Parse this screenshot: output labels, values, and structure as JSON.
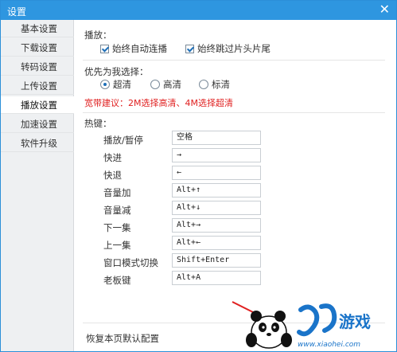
{
  "window": {
    "title": "设置",
    "close_glyph": "✕"
  },
  "sidebar": {
    "items": [
      {
        "label": "基本设置"
      },
      {
        "label": "下载设置"
      },
      {
        "label": "转码设置"
      },
      {
        "label": "上传设置"
      },
      {
        "label": "播放设置"
      },
      {
        "label": "加速设置"
      },
      {
        "label": "软件升级"
      }
    ],
    "active_index": 4
  },
  "playback": {
    "label": "播放：",
    "auto_continue": {
      "label": "始终自动连播",
      "checked": true
    },
    "skip_intro": {
      "label": "始终跳过片头片尾",
      "checked": true
    }
  },
  "quality": {
    "label": "优先为我选择：",
    "options": [
      {
        "label": "超清",
        "selected": true
      },
      {
        "label": "高清",
        "selected": false
      },
      {
        "label": "标清",
        "selected": false
      }
    ],
    "note": "宽带建议：2M选择高清、4M选择超清"
  },
  "hotkeys": {
    "label": "热键：",
    "rows": [
      {
        "label": "播放/暂停",
        "value": "空格"
      },
      {
        "label": "快进",
        "value": "→"
      },
      {
        "label": "快退",
        "value": "←"
      },
      {
        "label": "音量加",
        "value": "Alt+↑"
      },
      {
        "label": "音量减",
        "value": "Alt+↓"
      },
      {
        "label": "下一集",
        "value": "Alt+→"
      },
      {
        "label": "上一集",
        "value": "Alt+←"
      },
      {
        "label": "窗口模式切换",
        "value": "Shift+Enter"
      },
      {
        "label": "老板键",
        "value": "Alt+A"
      }
    ]
  },
  "footer": {
    "restore_label": "恢复本页默认配置"
  },
  "watermark": {
    "brand_text": "游戏",
    "url": "www.xiaohei.com"
  }
}
